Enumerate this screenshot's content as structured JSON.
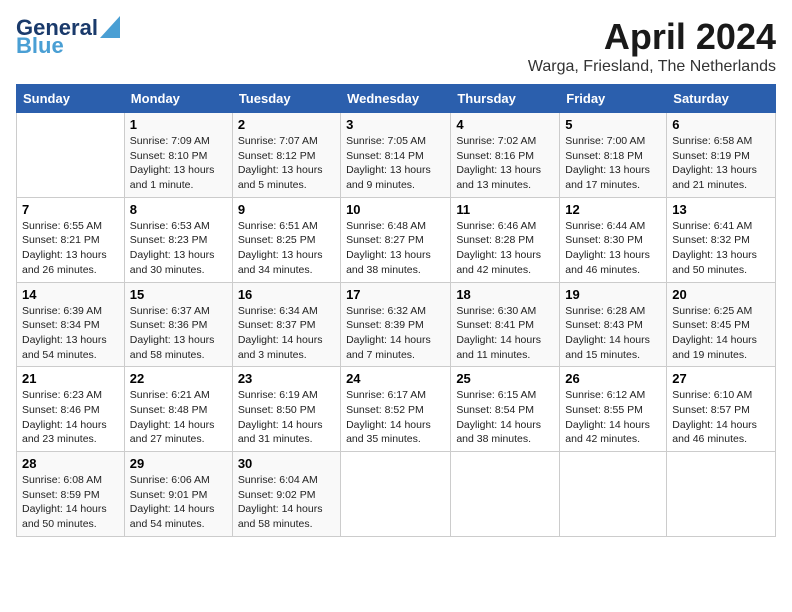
{
  "header": {
    "logo_general": "General",
    "logo_blue": "Blue",
    "month_year": "April 2024",
    "location": "Warga, Friesland, The Netherlands"
  },
  "columns": [
    "Sunday",
    "Monday",
    "Tuesday",
    "Wednesday",
    "Thursday",
    "Friday",
    "Saturday"
  ],
  "weeks": [
    [
      {
        "day": "",
        "sunrise": "",
        "sunset": "",
        "daylight": ""
      },
      {
        "day": "1",
        "sunrise": "7:09 AM",
        "sunset": "8:10 PM",
        "daylight": "13 hours and 1 minute."
      },
      {
        "day": "2",
        "sunrise": "7:07 AM",
        "sunset": "8:12 PM",
        "daylight": "13 hours and 5 minutes."
      },
      {
        "day": "3",
        "sunrise": "7:05 AM",
        "sunset": "8:14 PM",
        "daylight": "13 hours and 9 minutes."
      },
      {
        "day": "4",
        "sunrise": "7:02 AM",
        "sunset": "8:16 PM",
        "daylight": "13 hours and 13 minutes."
      },
      {
        "day": "5",
        "sunrise": "7:00 AM",
        "sunset": "8:18 PM",
        "daylight": "13 hours and 17 minutes."
      },
      {
        "day": "6",
        "sunrise": "6:58 AM",
        "sunset": "8:19 PM",
        "daylight": "13 hours and 21 minutes."
      }
    ],
    [
      {
        "day": "7",
        "sunrise": "6:55 AM",
        "sunset": "8:21 PM",
        "daylight": "13 hours and 26 minutes."
      },
      {
        "day": "8",
        "sunrise": "6:53 AM",
        "sunset": "8:23 PM",
        "daylight": "13 hours and 30 minutes."
      },
      {
        "day": "9",
        "sunrise": "6:51 AM",
        "sunset": "8:25 PM",
        "daylight": "13 hours and 34 minutes."
      },
      {
        "day": "10",
        "sunrise": "6:48 AM",
        "sunset": "8:27 PM",
        "daylight": "13 hours and 38 minutes."
      },
      {
        "day": "11",
        "sunrise": "6:46 AM",
        "sunset": "8:28 PM",
        "daylight": "13 hours and 42 minutes."
      },
      {
        "day": "12",
        "sunrise": "6:44 AM",
        "sunset": "8:30 PM",
        "daylight": "13 hours and 46 minutes."
      },
      {
        "day": "13",
        "sunrise": "6:41 AM",
        "sunset": "8:32 PM",
        "daylight": "13 hours and 50 minutes."
      }
    ],
    [
      {
        "day": "14",
        "sunrise": "6:39 AM",
        "sunset": "8:34 PM",
        "daylight": "13 hours and 54 minutes."
      },
      {
        "day": "15",
        "sunrise": "6:37 AM",
        "sunset": "8:36 PM",
        "daylight": "13 hours and 58 minutes."
      },
      {
        "day": "16",
        "sunrise": "6:34 AM",
        "sunset": "8:37 PM",
        "daylight": "14 hours and 3 minutes."
      },
      {
        "day": "17",
        "sunrise": "6:32 AM",
        "sunset": "8:39 PM",
        "daylight": "14 hours and 7 minutes."
      },
      {
        "day": "18",
        "sunrise": "6:30 AM",
        "sunset": "8:41 PM",
        "daylight": "14 hours and 11 minutes."
      },
      {
        "day": "19",
        "sunrise": "6:28 AM",
        "sunset": "8:43 PM",
        "daylight": "14 hours and 15 minutes."
      },
      {
        "day": "20",
        "sunrise": "6:25 AM",
        "sunset": "8:45 PM",
        "daylight": "14 hours and 19 minutes."
      }
    ],
    [
      {
        "day": "21",
        "sunrise": "6:23 AM",
        "sunset": "8:46 PM",
        "daylight": "14 hours and 23 minutes."
      },
      {
        "day": "22",
        "sunrise": "6:21 AM",
        "sunset": "8:48 PM",
        "daylight": "14 hours and 27 minutes."
      },
      {
        "day": "23",
        "sunrise": "6:19 AM",
        "sunset": "8:50 PM",
        "daylight": "14 hours and 31 minutes."
      },
      {
        "day": "24",
        "sunrise": "6:17 AM",
        "sunset": "8:52 PM",
        "daylight": "14 hours and 35 minutes."
      },
      {
        "day": "25",
        "sunrise": "6:15 AM",
        "sunset": "8:54 PM",
        "daylight": "14 hours and 38 minutes."
      },
      {
        "day": "26",
        "sunrise": "6:12 AM",
        "sunset": "8:55 PM",
        "daylight": "14 hours and 42 minutes."
      },
      {
        "day": "27",
        "sunrise": "6:10 AM",
        "sunset": "8:57 PM",
        "daylight": "14 hours and 46 minutes."
      }
    ],
    [
      {
        "day": "28",
        "sunrise": "6:08 AM",
        "sunset": "8:59 PM",
        "daylight": "14 hours and 50 minutes."
      },
      {
        "day": "29",
        "sunrise": "6:06 AM",
        "sunset": "9:01 PM",
        "daylight": "14 hours and 54 minutes."
      },
      {
        "day": "30",
        "sunrise": "6:04 AM",
        "sunset": "9:02 PM",
        "daylight": "14 hours and 58 minutes."
      },
      {
        "day": "",
        "sunrise": "",
        "sunset": "",
        "daylight": ""
      },
      {
        "day": "",
        "sunrise": "",
        "sunset": "",
        "daylight": ""
      },
      {
        "day": "",
        "sunrise": "",
        "sunset": "",
        "daylight": ""
      },
      {
        "day": "",
        "sunrise": "",
        "sunset": "",
        "daylight": ""
      }
    ]
  ],
  "labels": {
    "sunrise_prefix": "Sunrise: ",
    "sunset_prefix": "Sunset: ",
    "daylight_prefix": "Daylight: "
  }
}
